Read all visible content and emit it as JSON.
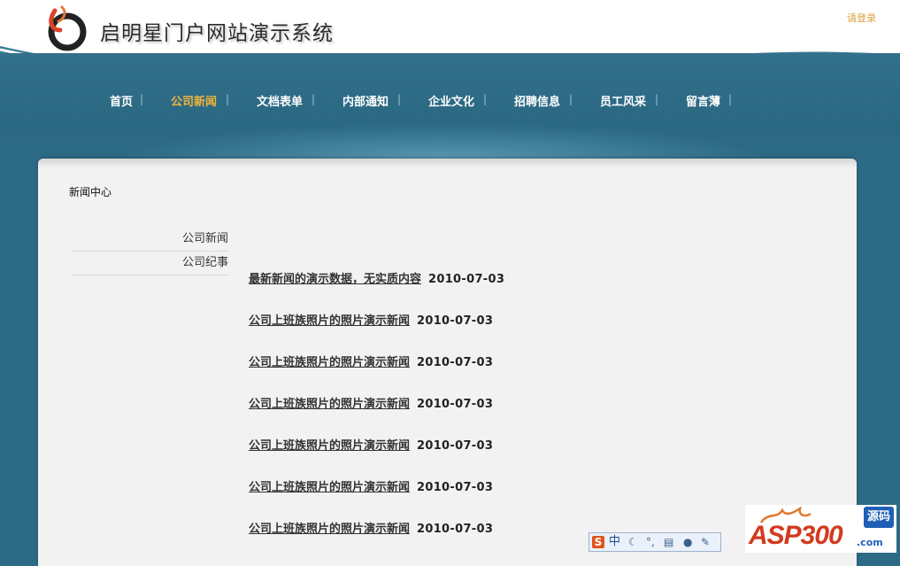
{
  "header": {
    "site_title": "启明星门户网站演示系统",
    "login_link": "请登录"
  },
  "nav": {
    "items": [
      {
        "label": "首页",
        "active": false
      },
      {
        "label": "公司新闻",
        "active": true
      },
      {
        "label": "文档表单",
        "active": false
      },
      {
        "label": "内部通知",
        "active": false
      },
      {
        "label": "企业文化",
        "active": false
      },
      {
        "label": "招聘信息",
        "active": false
      },
      {
        "label": "员工风采",
        "active": false
      },
      {
        "label": "留言薄",
        "active": false
      }
    ],
    "separator": "|"
  },
  "content": {
    "breadcrumb": "新闻中心",
    "sidebar": [
      {
        "label": "公司新闻"
      },
      {
        "label": "公司纪事"
      }
    ],
    "news": [
      {
        "title": "最新新闻的演示数据，无实质内容",
        "date": "2010-07-03"
      },
      {
        "title": "公司上班族照片的照片演示新闻",
        "date": "2010-07-03"
      },
      {
        "title": "公司上班族照片的照片演示新闻",
        "date": "2010-07-03"
      },
      {
        "title": "公司上班族照片的照片演示新闻",
        "date": "2010-07-03"
      },
      {
        "title": "公司上班族照片的照片演示新闻",
        "date": "2010-07-03"
      },
      {
        "title": "公司上班族照片的照片演示新闻",
        "date": "2010-07-03"
      },
      {
        "title": "公司上班族照片的照片演示新闻",
        "date": "2010-07-03"
      }
    ]
  },
  "ime_toolbar": {
    "logo": "S",
    "mode": "中",
    "icons": [
      "moon-icon",
      "punctuation-icon",
      "keyboard-icon",
      "user-icon",
      "wrench-icon"
    ]
  },
  "watermark": {
    "text": "ASP300",
    "badge": "源码",
    "suffix": ".com"
  },
  "colors": {
    "nav_active": "#f3b43a",
    "login_link": "#d9a33b",
    "band_blue": "#2d6a85"
  }
}
